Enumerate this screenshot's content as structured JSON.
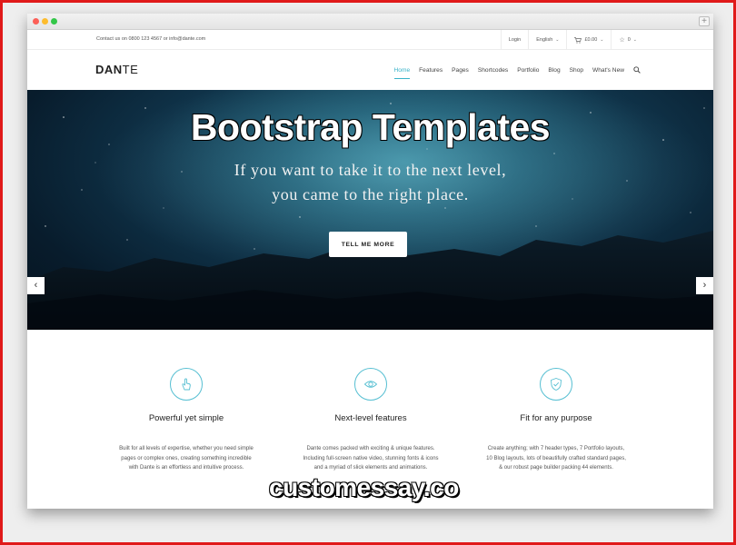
{
  "topbar": {
    "contact": "Contact us on 0800 123 4567 or info@dante.com",
    "login": "Login",
    "language": "English",
    "cart": "£0.00",
    "wishlist_count": "0"
  },
  "nav": {
    "logo_bold": "DAN",
    "logo_rest": "TE",
    "items": [
      "Home",
      "Features",
      "Pages",
      "Shortcodes",
      "Portfolio",
      "Blog",
      "Shop",
      "What's New"
    ]
  },
  "hero": {
    "title": "Bootstrap Templates",
    "subtitle_line1": "If you want to take it to the next level,",
    "subtitle_line2": "you came to the right place.",
    "button": "TELL ME MORE"
  },
  "features": [
    {
      "icon": "pointer-hand-icon",
      "title": "Powerful yet simple",
      "lines": [
        "Built for all levels of expertise, whether you need simple",
        "pages or complex ones, creating something incredible",
        "with Dante is an effortless and intuitive process."
      ]
    },
    {
      "icon": "eye-icon",
      "title": "Next-level features",
      "lines": [
        "Dante comes packed with exciting & unique features.",
        "Including full-screen native video, stunning fonts & icons",
        "and a myriad of slick elements and animations."
      ]
    },
    {
      "icon": "shield-icon",
      "title": "Fit for any purpose",
      "lines": [
        "Create anything; with 7 header types, 7 Portfolio layouts,",
        "10 Blog layouts, lots of beautifully crafted standard pages,",
        "& our robust page builder packing 44 elements."
      ]
    }
  ],
  "watermark": "customessay.co",
  "colors": {
    "accent": "#38b2c9",
    "frame": "#e01a1a"
  }
}
